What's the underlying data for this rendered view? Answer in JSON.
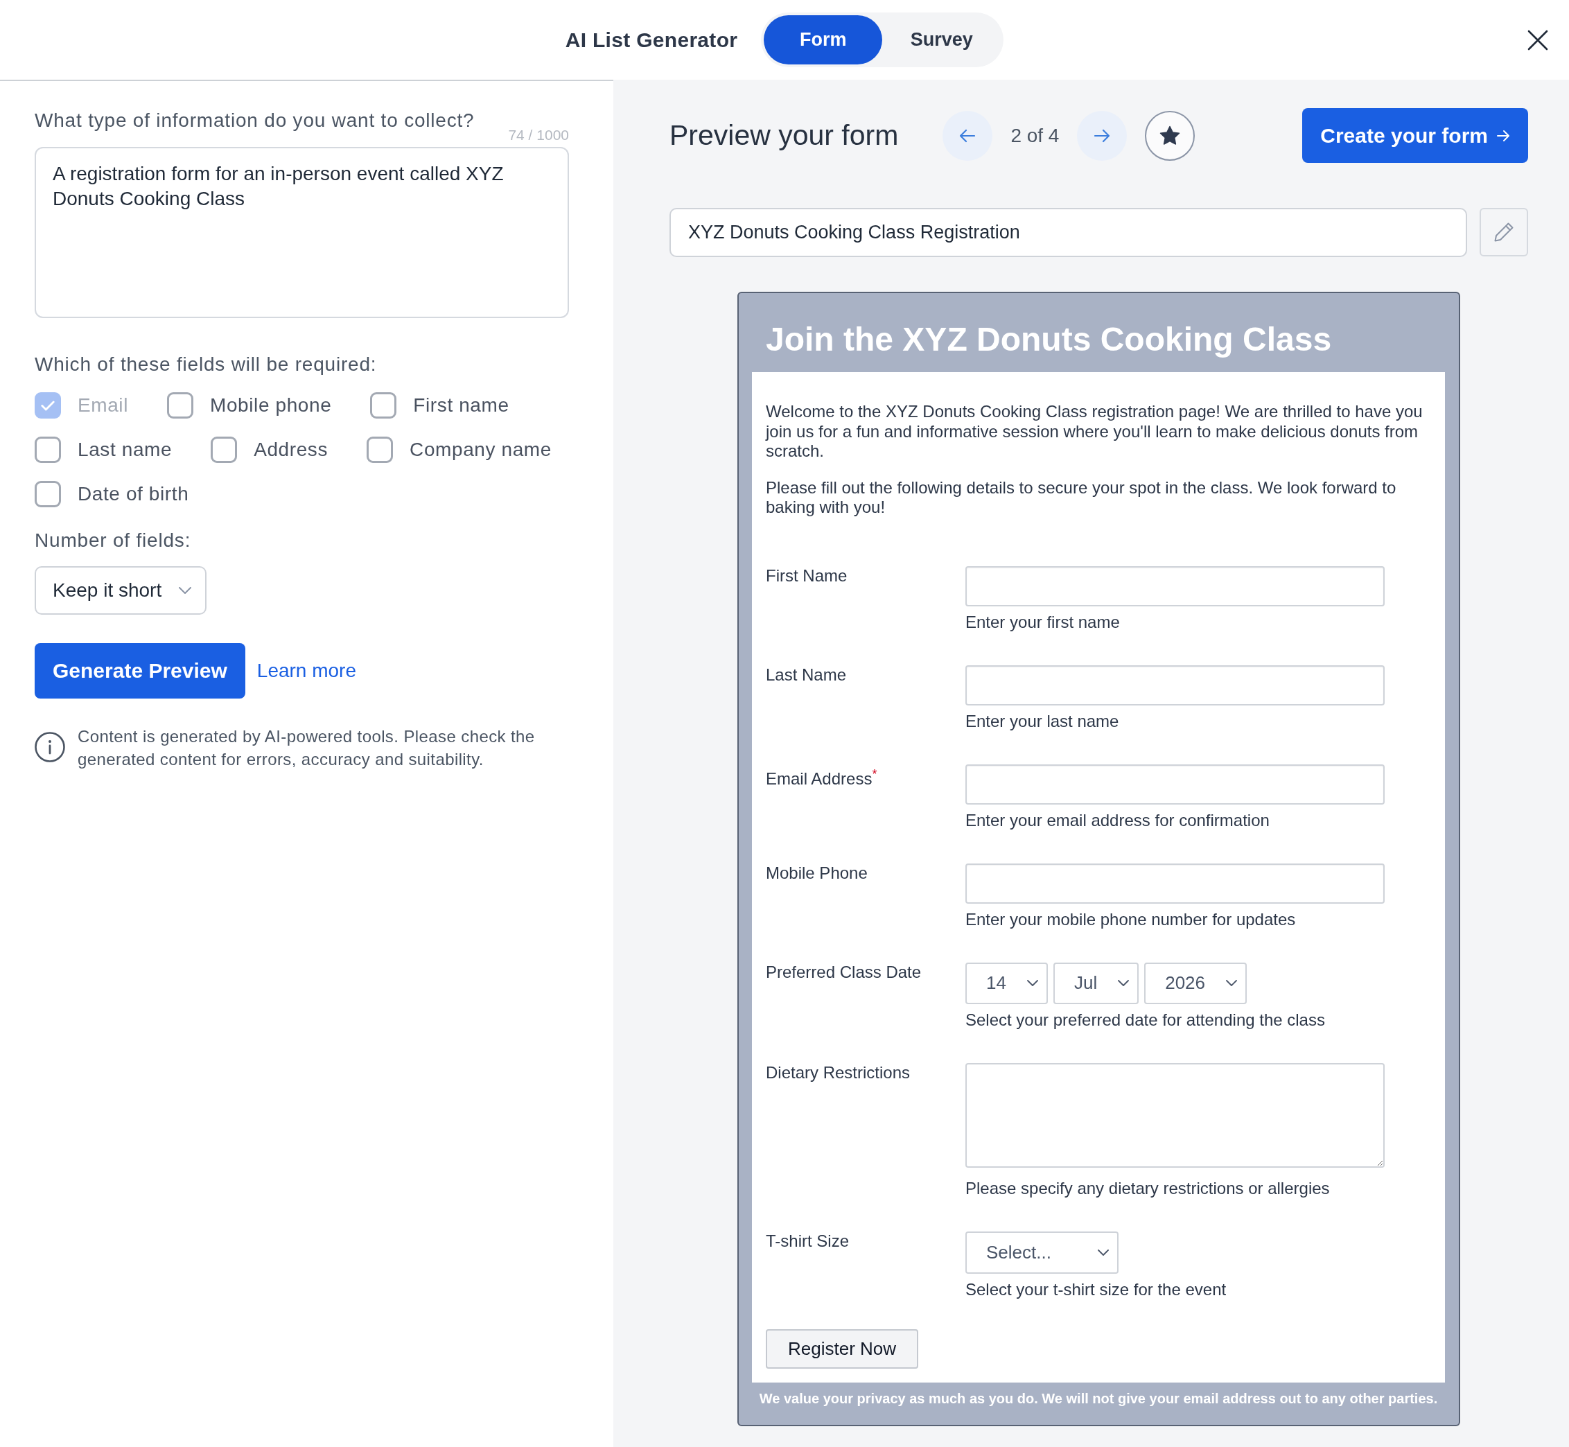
{
  "header": {
    "title": "AI List Generator",
    "tabs": [
      {
        "label": "Form",
        "selected": true
      },
      {
        "label": "Survey",
        "selected": false
      }
    ]
  },
  "prompt": {
    "label": "What type of information do you want to collect?",
    "counter": "74 / 1000",
    "value": "A registration form for an in-person event called XYZ Donuts Cooking Class"
  },
  "required_fields": {
    "label": "Which of these fields will be required:",
    "options": [
      {
        "label": "Email",
        "checked": true,
        "disabled": true
      },
      {
        "label": "Mobile phone",
        "checked": false,
        "disabled": false
      },
      {
        "label": "First name",
        "checked": false,
        "disabled": false
      },
      {
        "label": "Last name",
        "checked": false,
        "disabled": false
      },
      {
        "label": "Address",
        "checked": false,
        "disabled": false
      },
      {
        "label": "Company name",
        "checked": false,
        "disabled": false
      },
      {
        "label": "Date of birth",
        "checked": false,
        "disabled": false
      }
    ]
  },
  "number_of_fields": {
    "label": "Number of fields:",
    "value": "Keep it short"
  },
  "actions": {
    "generate_button": "Generate Preview",
    "learn_more_link": "Learn more"
  },
  "disclaimer": "Content is generated by AI-powered tools. Please check the generated content for errors, accuracy and suitability.",
  "preview": {
    "title": "Preview your form",
    "pager": "2 of 4",
    "create_button": "Create your form",
    "form_name": "XYZ Donuts Cooking Class Registration"
  },
  "form": {
    "title": "Join the XYZ Donuts Cooking Class",
    "intro": [
      "Welcome to the XYZ Donuts Cooking Class registration page! We are thrilled to have you join us for a fun and informative session where you'll learn to make delicious donuts from scratch.",
      "Please fill out the following details to secure your spot in the class. We look forward to baking with you!"
    ],
    "fields": [
      {
        "kind": "text",
        "label": "First Name",
        "hint": "Enter your first name"
      },
      {
        "kind": "text",
        "label": "Last Name",
        "hint": "Enter your last name"
      },
      {
        "kind": "text",
        "label": "Email Address$^{*}$",
        "hint": "Enter your email address for confirmation"
      },
      {
        "kind": "text",
        "label": "Mobile Phone",
        "hint": "Enter your mobile phone number for updates"
      },
      {
        "kind": "date",
        "label": "Preferred Class Date",
        "selects": [
          "14",
          "Jul",
          "2026"
        ],
        "hint": "Select your preferred date for attending the class"
      },
      {
        "kind": "textarea",
        "label": "Dietary Restrictions",
        "hint": "Please specify any dietary restrictions or allergies"
      },
      {
        "kind": "select",
        "label": "T-shirt Size",
        "placeholder": "Select...",
        "hint": "Select your t-shirt size for the event"
      }
    ],
    "submit_button": "Register Now",
    "footer": "We value your privacy as much as you do. We will not give your email address out to any other parties."
  }
}
